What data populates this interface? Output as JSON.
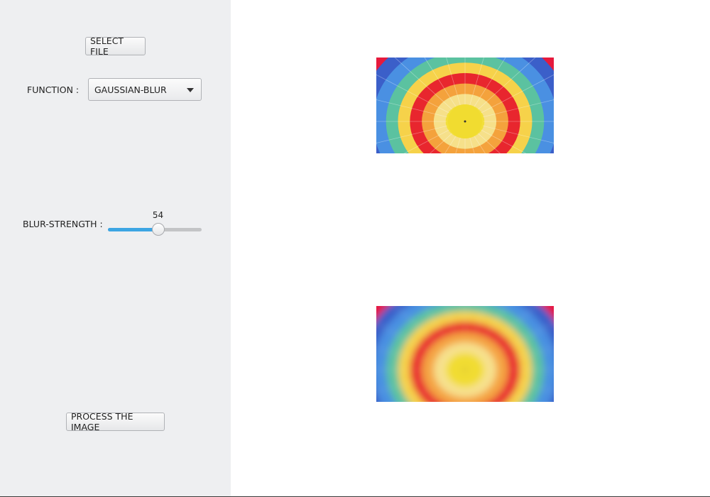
{
  "controls": {
    "select_file_label": "SELECT FILE",
    "function_label": "FUNCTION :",
    "function_selected": "GAUSSIAN-BLUR",
    "blur_strength_label": "BLUR-STRENGTH :",
    "blur_strength_value": "54",
    "blur_strength_min": 0,
    "blur_strength_max": 100,
    "process_label": "PROCESS THE IMAGE"
  },
  "images": {
    "original": {
      "subject": "rainbow hot-air balloon interior, viewed from below"
    },
    "processed": {
      "subject": "same balloon image with gaussian blur applied"
    }
  },
  "colors": {
    "panel_background": "#eeeff1",
    "slider_fill": "#3ca5e3",
    "slider_track": "#c3c4c6"
  },
  "icons": {
    "dropdown": "chevron-down-icon"
  }
}
